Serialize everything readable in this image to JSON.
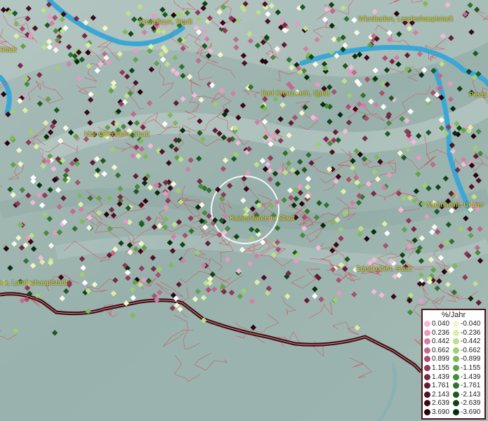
{
  "cities": [
    {
      "name": "Kastellaun, Stadt",
      "id": "kastellaun"
    },
    {
      "name": "Wiesbaden, Landeshauptstadt",
      "id": "wiesbaden"
    },
    {
      "name": "Stadt",
      "id": "stadt-left"
    },
    {
      "name": "Bad Kreuznach, Stadt",
      "id": "bad-kreuznach"
    },
    {
      "name": "Pieds",
      "id": "pieds"
    },
    {
      "name": "Idar-Oberstein, Stadt",
      "id": "idar-oberstein"
    },
    {
      "name": "Kaiserslautern, Stadt",
      "id": "kaiserslautern"
    },
    {
      "name": "Mannheim, Univer",
      "id": "mannheim"
    },
    {
      "name": "Edenkoben, Stadt",
      "id": "edenkoben"
    },
    {
      "name": "en, Landeshauptstadt",
      "id": "mainz"
    }
  ],
  "legend": {
    "title": "%/Jahr",
    "positive": [
      "0.040",
      "0.236",
      "0.442",
      "0.662",
      "0.899",
      "1.155",
      "1.439",
      "1.761",
      "2.143",
      "2.639",
      "3.690"
    ],
    "negative": [
      "-0.040",
      "-0.236",
      "-0.442",
      "-0.662",
      "-0.899",
      "-1.155",
      "-1.439",
      "-1.761",
      "-2.143",
      "-2.639",
      "-3.690"
    ],
    "positive_colors": [
      "#f4b8d8",
      "#e89ac0",
      "#d47ea6",
      "#c06a8c",
      "#a85070",
      "#8e3a58",
      "#762a44",
      "#621c34",
      "#4e1024",
      "#3a0818",
      "#22040c"
    ],
    "negative_colors": [
      "#f2f7c8",
      "#dcefa8",
      "#bfe08a",
      "#9fcd72",
      "#80b85c",
      "#62a24a",
      "#468a3a",
      "#2f722c",
      "#1d5a20",
      "#104416",
      "#062e0c"
    ]
  }
}
